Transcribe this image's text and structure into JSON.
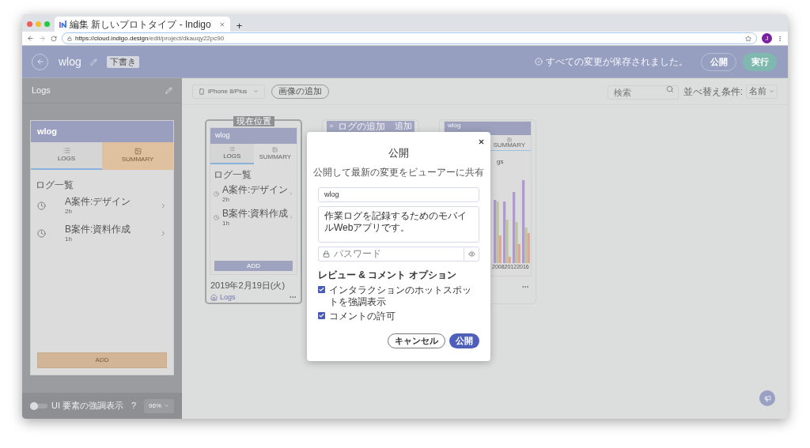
{
  "browser": {
    "tab_title": "編集 新しいプロトタイプ - Indigo",
    "new_tab": "+",
    "url_host": "https://cloud.indigo.design",
    "url_path": "/edit/project/dkauqy22pc90",
    "profile": "J"
  },
  "header": {
    "project": "wlog",
    "badge": "下書き",
    "status": "すべての変更が保存されました。",
    "publish": "公開",
    "run": "実行"
  },
  "sidebar": {
    "title": "Logs",
    "preview": {
      "app_title": "wlog",
      "tabs": [
        {
          "label": "LOGS",
          "selected": true
        },
        {
          "label": "SUMMARY",
          "selected": false
        }
      ],
      "section": "ログ一覧",
      "items": [
        {
          "title": "A案件:デザイン",
          "sub": "2h"
        },
        {
          "title": "B案件:資料作成",
          "sub": "1h"
        }
      ],
      "add": "ADD"
    },
    "footer": {
      "toggle_label": "UI 要素の強調表示",
      "toggle_on": false,
      "help": "?",
      "zoom": "96%"
    }
  },
  "toolbar": {
    "device": "iPhone 8/Plus",
    "add_image": "画像の追加",
    "search_placeholder": "検索",
    "sort_label": "並べ替え条件:",
    "sort": "名前"
  },
  "cards": [
    {
      "kind": "screen",
      "selected": true,
      "badge": "現在位置",
      "app_title": "wlog",
      "tabs": [
        {
          "label": "LOGS",
          "selected": true
        },
        {
          "label": "SUMMARY",
          "selected": false
        }
      ],
      "section": "ログ一覧",
      "items": [
        {
          "title": "A案件:デザイン",
          "sub": "2h"
        },
        {
          "title": "B案件:資料作成",
          "sub": "1h"
        }
      ],
      "add": "ADD",
      "date": "2019年2月19日(火)",
      "name": "Logs"
    },
    {
      "kind": "covered",
      "selected": false,
      "header": "ログの追加",
      "action": "追加"
    },
    {
      "kind": "chart",
      "selected": false,
      "app_title": "wlog",
      "tab": "SUMMARY",
      "chart_title": "gs",
      "x_labels": [
        "2008",
        "2012",
        "2016"
      ]
    }
  ],
  "modal": {
    "title": "公開",
    "subtitle": "公開して最新の変更をビューアーに共有",
    "name": "wlog",
    "description": "作業ログを記録するためのモバイルWebアプリです。",
    "password_placeholder": "パスワード",
    "options_title": "レビュー & コメント オプション",
    "options": [
      {
        "label": "インタラクションのホットスポットを強調表示",
        "checked": true
      },
      {
        "label": "コメントの許可",
        "checked": true
      }
    ],
    "cancel": "キャンセル",
    "publish": "公開"
  }
}
